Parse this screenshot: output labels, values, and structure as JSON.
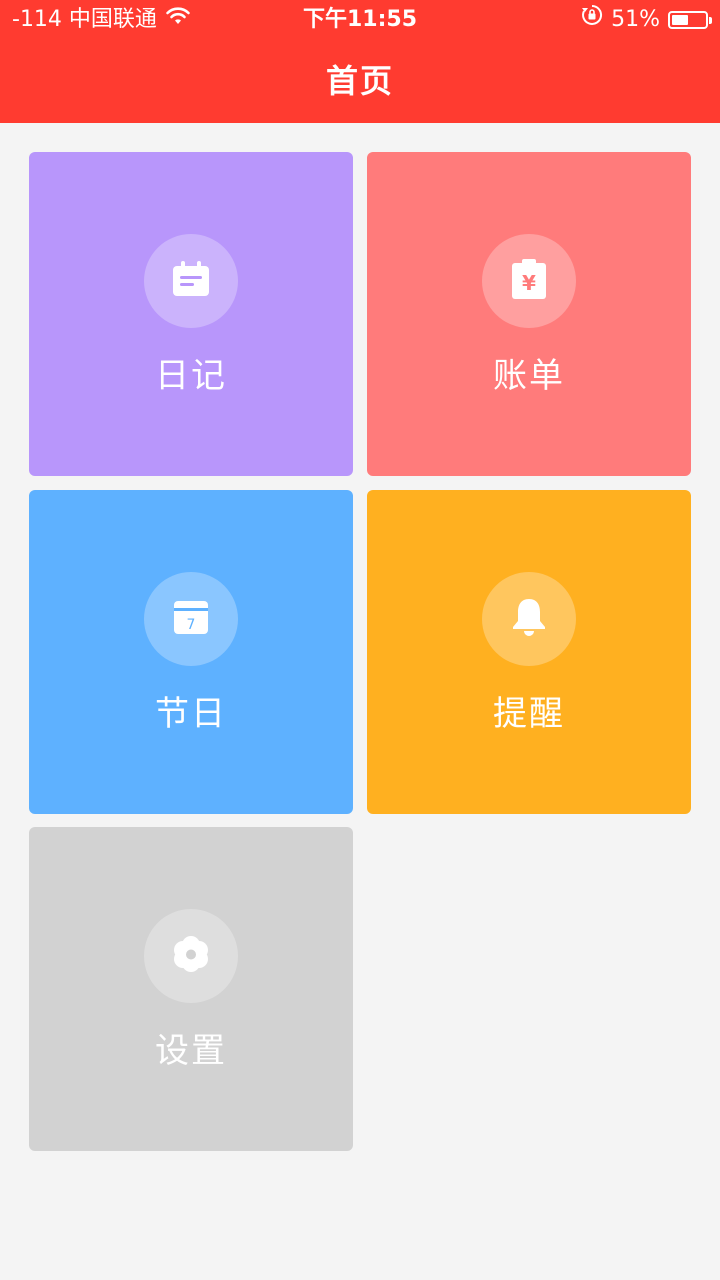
{
  "status_bar": {
    "carrier": "-114 中国联通",
    "time": "下午11:55",
    "battery": "51%",
    "battery_level": 0.51
  },
  "header": {
    "title": "首页"
  },
  "tiles": [
    {
      "label": "日记",
      "icon": "diary-icon",
      "color": "#b896fb"
    },
    {
      "label": "账单",
      "icon": "bill-icon",
      "color": "#ff7b7b"
    },
    {
      "label": "节日",
      "icon": "calendar-icon",
      "color": "#5eb1ff"
    },
    {
      "label": "提醒",
      "icon": "bell-icon",
      "color": "#ffb020"
    },
    {
      "label": "设置",
      "icon": "gear-icon",
      "color": "#d2d2d2"
    }
  ],
  "icons": {
    "calendar_day": "7",
    "bill_symbol": "¥"
  }
}
